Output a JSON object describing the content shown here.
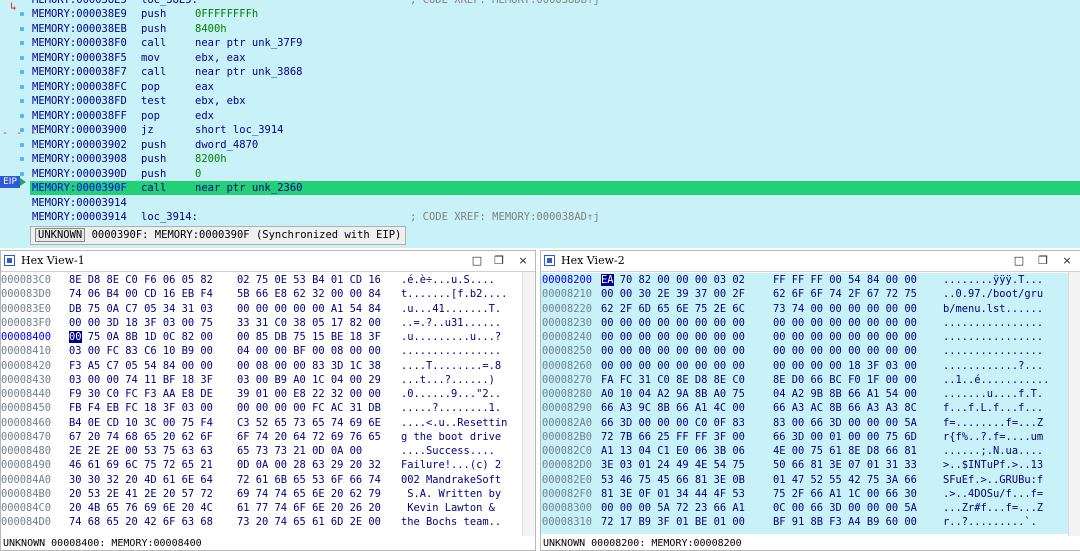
{
  "disasm": {
    "lines": [
      {
        "addr": "MEMORY:000038E9",
        "mn": "push",
        "op": "0FFFFFFFFh",
        "opnum": true
      },
      {
        "addr": "MEMORY:000038EB",
        "mn": "push",
        "op": "8400h",
        "opnum": true
      },
      {
        "addr": "MEMORY:000038F0",
        "mn": "call",
        "op": "near ptr unk_37F9"
      },
      {
        "addr": "MEMORY:000038F5",
        "mn": "mov",
        "op": "ebx, eax"
      },
      {
        "addr": "MEMORY:000038F7",
        "mn": "call",
        "op": "near ptr unk_3868"
      },
      {
        "addr": "MEMORY:000038FC",
        "mn": "pop",
        "op": "eax"
      },
      {
        "addr": "MEMORY:000038FD",
        "mn": "test",
        "op": "ebx, ebx"
      },
      {
        "addr": "MEMORY:000038FF",
        "mn": "pop",
        "op": "edx"
      },
      {
        "addr": "MEMORY:00003900",
        "mn": "jz",
        "op": "short loc_3914"
      },
      {
        "addr": "MEMORY:00003902",
        "mn": "push",
        "op": "dword_4870"
      },
      {
        "addr": "MEMORY:00003908",
        "mn": "push",
        "op": "8200h",
        "opnum": true
      },
      {
        "addr": "MEMORY:0000390D",
        "mn": "push",
        "op": "0",
        "opnum": true
      },
      {
        "addr": "MEMORY:0000390F",
        "mn": "call",
        "op": "near ptr unk_2360",
        "eip": true
      },
      {
        "addr": "MEMORY:00003914",
        "mn": "",
        "op": ""
      },
      {
        "addr": "MEMORY:00003914",
        "mn": "loc_3914:",
        "op": "",
        "cm": "; CODE XREF: MEMORY:000038AD↑j"
      }
    ],
    "top_partial": {
      "addr": "MEMORY:000038E5",
      "mn": "loc_38E5:",
      "cm": "; CODE XREF: MEMORY:000038DB↑j"
    },
    "eip_label": "EIP",
    "status_mode": "UNKNOWN",
    "status_text": "0000390F: MEMORY:0000390F (Synchronized with EIP)"
  },
  "hex1": {
    "title": "Hex View-1",
    "rows": [
      {
        "a": "000083C0",
        "b1": "8E D8 8E C0 F6 06 05 82",
        "b2": "02 75 0E 53 B4 01 CD 16",
        "asc": ".é.è÷...u.S...."
      },
      {
        "a": "000083D0",
        "b1": "74 06 B4 00 CD 16 EB F4",
        "b2": "5B 66 E8 62 32 00 00 84",
        "asc": "t.......[f.b2...."
      },
      {
        "a": "000083E0",
        "b1": "DB 75 0A C7 05 34 31 03",
        "b2": "00 00 00 00 00 A1 54 84",
        "asc": ".u...41.......T."
      },
      {
        "a": "000083F0",
        "b1": "00 00 3D 18 3F 03 00 75",
        "b2": "33 31 C0 38 05 17 82 00",
        "asc": "..=.?..u31......"
      },
      {
        "a": "00008400",
        "b1": "0A 75 0A 8B 1D 0C 82 00",
        "b2": "00 85 DB 75 15 BE 18 3F",
        "asc": ".u.........u...?",
        "cur": true,
        "curbyte": "00",
        "b1rest": " 75 0A 8B 1D 0C 82 00"
      },
      {
        "a": "00008410",
        "b1": "03 00 FC 83 C6 10 B9 00",
        "b2": "04 00 00 BF 00 08 00 00",
        "asc": "................"
      },
      {
        "a": "00008420",
        "b1": "F3 A5 C7 05 54 84 00 00",
        "b2": "00 08 00 00 83 3D 1C 38",
        "asc": "....T........=.8"
      },
      {
        "a": "00008430",
        "b1": "03 00 00 74 11 BF 18 3F",
        "b2": "03 00 B9 A0 1C 04 00 29",
        "asc": "...t...?......)"
      },
      {
        "a": "00008440",
        "b1": "F9 30 C0 FC F3 AA E8 DE",
        "b2": "39 01 00 E8 22 32 00 00",
        "asc": ".0......9...\"2.."
      },
      {
        "a": "00008450",
        "b1": "FB F4 EB FC 18 3F 03 00",
        "b2": "00 00 00 00 FC AC 31 DB",
        "asc": ".....?........1."
      },
      {
        "a": "00008460",
        "b1": "B4 0E CD 10 3C 00 75 F4",
        "b2": "C3 52 65 73 65 74 69 6E",
        "asc": "....<.u..Resettin"
      },
      {
        "a": "00008470",
        "b1": "67 20 74 68 65 20 62 6F",
        "b2": "6F 74 20 64 72 69 76 65",
        "asc": "g the boot drive"
      },
      {
        "a": "00008480",
        "b1": "2E 2E 2E 00 53 75 63 63",
        "b2": "65 73 73 21 0D 0A 00",
        "asc": "....Success...."
      },
      {
        "a": "00008490",
        "b1": "46 61 69 6C 75 72 65 21",
        "b2": "0D 0A 00 28 63 29 20 32",
        "asc": "Failure!...(c) 2"
      },
      {
        "a": "000084A0",
        "b1": "30 30 32 20 4D 61 6E 64",
        "b2": "72 61 6B 65 53 6F 66 74",
        "asc": "002 MandrakeSoft"
      },
      {
        "a": "000084B0",
        "b1": "20 53 2E 41 2E 20 57 72",
        "b2": "69 74 74 65 6E 20 62 79",
        "asc": " S.A. Written by"
      },
      {
        "a": "000084C0",
        "b1": "20 4B 65 76 69 6E 20 4C",
        "b2": "61 77 74 6F 6E 20 26 20",
        "asc": " Kevin Lawton & "
      },
      {
        "a": "000084D0",
        "b1": "74 68 65 20 42 6F 63 68",
        "b2": "73 20 74 65 61 6D 2E 00",
        "asc": "the Bochs team.."
      }
    ],
    "status": "UNKNOWN 00008400: MEMORY:00008400"
  },
  "hex2": {
    "title": "Hex View-2",
    "rows": [
      {
        "a": "00008200",
        "b1": "EA 70 82 00 00 00 03 02",
        "b2": "FF FF FF 00 54 84 00 00",
        "asc": "........ÿÿÿ.T...",
        "cur": true,
        "curbyte": "EA",
        "b1rest": " 70 82 00 00 00 03 02"
      },
      {
        "a": "00008210",
        "b1": "00 00 30 2E 39 37 00 2F",
        "b2": "62 6F 6F 74 2F 67 72 75",
        "asc": "..0.97./boot/gru"
      },
      {
        "a": "00008220",
        "b1": "62 2F 6D 65 6E 75 2E 6C",
        "b2": "73 74 00 00 00 00 00 00",
        "asc": "b/menu.lst......"
      },
      {
        "a": "00008230",
        "b1": "00 00 00 00 00 00 00 00",
        "b2": "00 00 00 00 00 00 00 00",
        "asc": "................"
      },
      {
        "a": "00008240",
        "b1": "00 00 00 00 00 00 00 00",
        "b2": "00 00 00 00 00 00 00 00",
        "asc": "................"
      },
      {
        "a": "00008250",
        "b1": "00 00 00 00 00 00 00 00",
        "b2": "00 00 00 00 00 00 00 00",
        "asc": "................"
      },
      {
        "a": "00008260",
        "b1": "00 00 00 00 00 00 00 00",
        "b2": "00 00 00 00 18 3F 03 00",
        "asc": "............?..."
      },
      {
        "a": "00008270",
        "b1": "FA FC 31 C0 8E D8 8E C0",
        "b2": "8E D0 66 BC F0 1F 00 00",
        "asc": "..1..é..........."
      },
      {
        "a": "00008280",
        "b1": "A0 10 04 A2 9A 8B A0 75",
        "b2": "04 A2 9B 8B 66 A1 54 00",
        "asc": ".......u....f.T."
      },
      {
        "a": "00008290",
        "b1": "66 A3 9C 8B 66 A1 4C 00",
        "b2": "66 A3 AC 8B 66 A3 A3 8C",
        "asc": "f...f.L.f...f..."
      },
      {
        "a": "000082A0",
        "b1": "66 3D 00 00 00 C0 0F 83",
        "b2": "83 00 66 3D 00 00 00 5A",
        "asc": "f=........f=...Z"
      },
      {
        "a": "000082B0",
        "b1": "72 7B 66 25 FF FF 3F 00",
        "b2": "66 3D 00 01 00 00 75 6D",
        "asc": "r{f%..?.f=....um"
      },
      {
        "a": "000082C0",
        "b1": "A1 13 04 C1 E0 06 3B 06",
        "b2": "4E 00 75 61 8E D8 66 81",
        "asc": "......;.N.ua...."
      },
      {
        "a": "000082D0",
        "b1": "3E 03 01 24 49 4E 54 75",
        "b2": "50 66 81 3E 07 01 31 33",
        "asc": ">..$INTuPf.>..13"
      },
      {
        "a": "000082E0",
        "b1": "53 46 75 45 66 81 3E 0B",
        "b2": "01 47 52 55 42 75 3A 66",
        "asc": "SFuEf.>..GRUBu:f"
      },
      {
        "a": "000082F0",
        "b1": "81 3E 0F 01 34 44 4F 53",
        "b2": "75 2F 66 A1 1C 00 66 30",
        "asc": ".>..4DOSu/f...f="
      },
      {
        "a": "00008300",
        "b1": "00 00 00 5A 72 23 66 A1",
        "b2": "0C 00 66 3D 00 00 00 5A",
        "asc": "...Zr#f...f=...Z"
      },
      {
        "a": "00008310",
        "b1": "72 17 B9 3F 01 BE 01 00",
        "b2": "BF 91 8B F3 A4 B9 60 00",
        "asc": "r..?.........`."
      }
    ],
    "status": "UNKNOWN 00008200: MEMORY:00008200"
  },
  "window_buttons": {
    "restore": "□",
    "float": "❐",
    "close": "×"
  }
}
